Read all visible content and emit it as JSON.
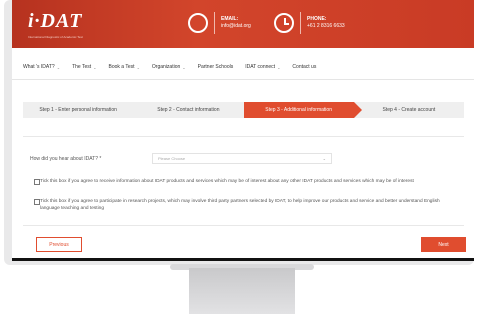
{
  "brand": {
    "logo_text": "i·DAT",
    "tagline": "International Diagnostic of Academic Test"
  },
  "header": {
    "email_label": "EMAIL:",
    "email_value": "info@idat.org",
    "phone_label": "PHONE:",
    "phone_value": "+61 2 8316 6633",
    "accent_color": "#d2452b"
  },
  "nav": {
    "items": [
      {
        "label": "What 's IDAT?",
        "dropdown": true
      },
      {
        "label": "The Test",
        "dropdown": true
      },
      {
        "label": "Book a Test",
        "dropdown": true
      },
      {
        "label": "Organization",
        "dropdown": true
      },
      {
        "label": "Partner Schools",
        "dropdown": false
      },
      {
        "label": "IDAT connect",
        "dropdown": true
      },
      {
        "label": "Contact us",
        "dropdown": false
      }
    ]
  },
  "steps": [
    {
      "label": "Step 1 - Enter personal information",
      "active": false
    },
    {
      "label": "Step 2 - Contact information",
      "active": false
    },
    {
      "label": "Step 3 - Additional information",
      "active": true
    },
    {
      "label": "Step 4 - Create account",
      "active": false
    }
  ],
  "form": {
    "hear_label": "How did you hear about IDAT? *",
    "hear_placeholder": "Please Choose",
    "check_marketing": "Tick this box if you agree to receive information about IDAT products and services which may be of interest about any other IDAT products and services which may be of interest",
    "check_research": "Tick this box if you agree to participate in research projects, which may involve third party partners selected by IDAT, to help improve our products and service and better understand English language teaching and testing"
  },
  "buttons": {
    "previous": "Previous",
    "next": "Next"
  },
  "icons": {
    "email": "email-icon",
    "phone": "clock-icon",
    "dropdown": "chevron-down-icon"
  }
}
